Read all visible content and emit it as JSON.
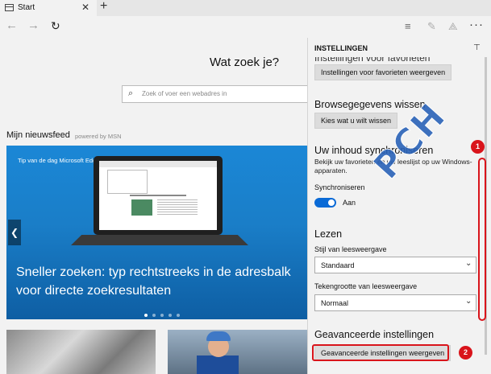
{
  "browser": {
    "tab_title": "Start",
    "tab_close": "✕",
    "new_tab": "+",
    "back": "←",
    "forward": "→",
    "refresh": "↻",
    "tools": {
      "hub": "≡",
      "note": "✎",
      "share": "⟁",
      "more": "···"
    }
  },
  "start_page": {
    "search_heading": "Wat zoek je?",
    "search_placeholder": "Zoek of voer een webadres in",
    "feed_title": "Mijn nieuwsfeed",
    "feed_source": "powered by MSN",
    "hero": {
      "tag": "Tip van de dag Microsoft Edge",
      "caption": "Sneller zoeken: typ rechtstreeks in de adresbalk voor directe zoekresultaten",
      "slide_count": 5,
      "active_slide": 1
    }
  },
  "settings": {
    "panel_title": "INSTELLINGEN",
    "favorites_heading": "Instellingen voor favorieten",
    "favorites_button": "Instellingen voor favorieten weergeven",
    "browsing_heading": "Browsegegevens wissen",
    "browsing_button": "Kies wat u wilt wissen",
    "sync_heading": "Uw inhoud synchroniseren",
    "sync_description": "Bekijk uw favorieten en uw leeslijst op uw Windows-apparaten.",
    "sync_label": "Synchroniseren",
    "sync_state": "Aan",
    "reading_heading": "Lezen",
    "reading_style_label": "Stijl van leesweergave",
    "reading_style_value": "Standaard",
    "reading_size_label": "Tekengrootte van leesweergave",
    "reading_size_value": "Normaal",
    "advanced_heading": "Geavanceerde instellingen",
    "advanced_button": "Geavanceerde instellingen weergeven"
  },
  "annotations": {
    "watermark": "PCH",
    "marker_1": "1",
    "marker_2": "2",
    "highlight_color": "#d9141b"
  },
  "colors": {
    "accent": "#0a6ad6",
    "hero_blue": "#1b87d6"
  }
}
